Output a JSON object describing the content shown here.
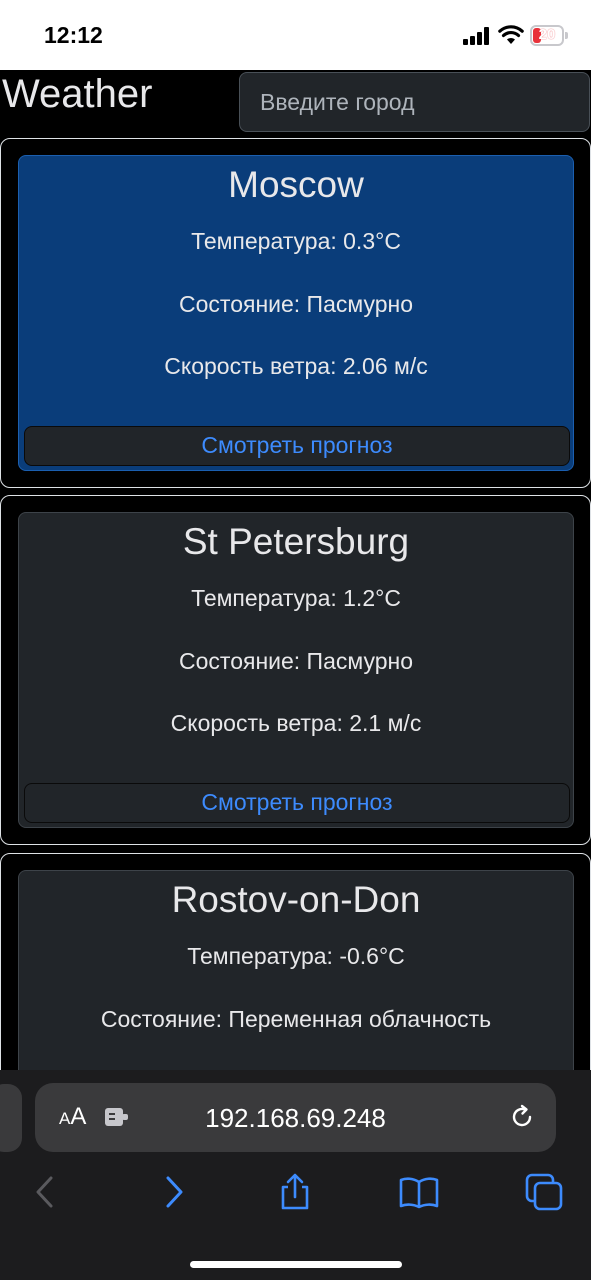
{
  "status_bar": {
    "time": "12:12",
    "battery": "20"
  },
  "header": {
    "title": "Weather",
    "search_placeholder": "Введите город"
  },
  "cards": [
    {
      "city": "Moscow",
      "temperature": "Температура: 0.3°C",
      "condition": "Состояние: Пасмурно",
      "wind": "Скорость ветра: 2.06 м/с",
      "button": "Смотреть прогноз",
      "active": true
    },
    {
      "city": "St Petersburg",
      "temperature": "Температура: 1.2°C",
      "condition": "Состояние: Пасмурно",
      "wind": "Скорость ветра: 2.1 м/с",
      "button": "Смотреть прогноз",
      "active": false
    },
    {
      "city": "Rostov-on-Don",
      "temperature": "Температура: -0.6°C",
      "condition": "Состояние: Переменная облачность"
    }
  ],
  "browser": {
    "aa_label_small": "A",
    "aa_label_large": "A",
    "url": "192.168.69.248"
  },
  "colors": {
    "active_card": "#0a3d7a",
    "card": "#212529",
    "link": "#3d8bfd",
    "toolbar_active": "#3d8bfd",
    "toolbar_disabled": "#5a5a5e"
  },
  "icons": [
    "signal-icon",
    "wifi-icon",
    "battery-icon",
    "extension-icon",
    "reload-icon",
    "back-icon",
    "forward-icon",
    "share-icon",
    "bookmarks-icon",
    "tabs-icon"
  ]
}
